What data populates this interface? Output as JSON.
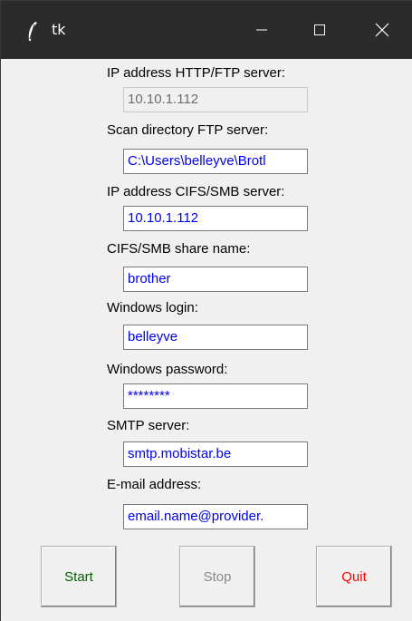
{
  "window": {
    "title": "tk"
  },
  "fields": [
    {
      "label": "IP address HTTP/FTP server:",
      "value": "10.10.1.112",
      "state": "disabled"
    },
    {
      "label": "Scan directory FTP server:",
      "value": "C:\\Users\\belleyve\\Brotl",
      "state": "normal"
    },
    {
      "label": "IP address CIFS/SMB server:",
      "value": "10.10.1.112",
      "state": "normal"
    },
    {
      "label": "CIFS/SMB share name:",
      "value": "brother",
      "state": "normal"
    },
    {
      "label": "Windows login:",
      "value": "belleyve",
      "state": "normal"
    },
    {
      "label": "Windows password:",
      "value": "********",
      "state": "normal"
    },
    {
      "label": "SMTP server:",
      "value": "smtp.mobistar.be",
      "state": "normal"
    },
    {
      "label": "E-mail address:",
      "value": "email.name@provider.",
      "state": "normal"
    }
  ],
  "buttons": {
    "start": "Start",
    "stop": "Stop",
    "quit": "Quit"
  },
  "colors": {
    "entry_text": "#0000ee",
    "start": "#006400",
    "stop_disabled": "#8a8a8a",
    "quit": "#ff0000"
  }
}
